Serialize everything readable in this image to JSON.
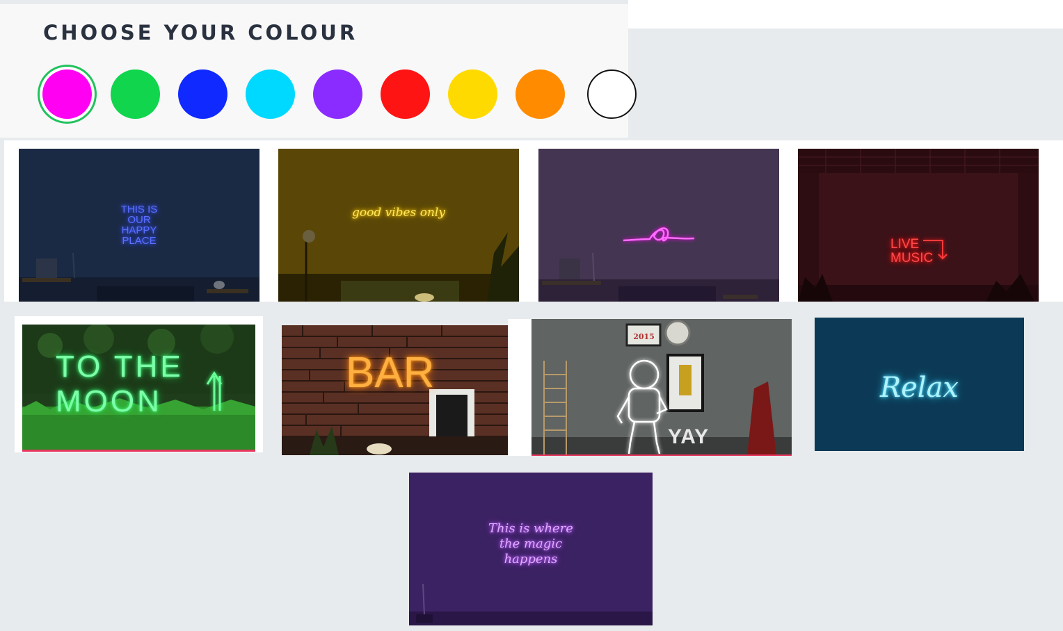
{
  "picker": {
    "title": "CHOOSE YOUR COLOUR",
    "selected": "pink",
    "swatches": [
      {
        "name": "pink",
        "color": "#ff00f2"
      },
      {
        "name": "green",
        "color": "#10d54d"
      },
      {
        "name": "blue",
        "color": "#0f29ff"
      },
      {
        "name": "ice-blue",
        "color": "#00d9ff"
      },
      {
        "name": "purple",
        "color": "#8a2bff"
      },
      {
        "name": "red",
        "color": "#ff1414"
      },
      {
        "name": "yellow",
        "color": "#ffda00"
      },
      {
        "name": "orange",
        "color": "#ff8c00"
      },
      {
        "name": "white",
        "color": "#ffffff"
      }
    ]
  },
  "gallery": {
    "signs": [
      {
        "text": "THIS IS\nOUR\nHAPPY\nPLACE",
        "color": "#3c55ff"
      },
      {
        "text": "good vibes only",
        "color": "#ffd400"
      },
      {
        "text": "LIVE\nMUSIC",
        "color": "#ff2a2a"
      },
      {
        "text": "TO THE\nMOON",
        "color": "#3dff7a"
      },
      {
        "text": "BAR",
        "color": "#ff9a1a"
      },
      {
        "text": "2015",
        "color": "#b03030"
      },
      {
        "text": "YAY",
        "color": "#e8e8e8"
      },
      {
        "text": "Relax",
        "color": "#5fe6ff"
      },
      {
        "text": "This is where\nthe magic\nhappens",
        "color": "#c46bff"
      }
    ]
  }
}
